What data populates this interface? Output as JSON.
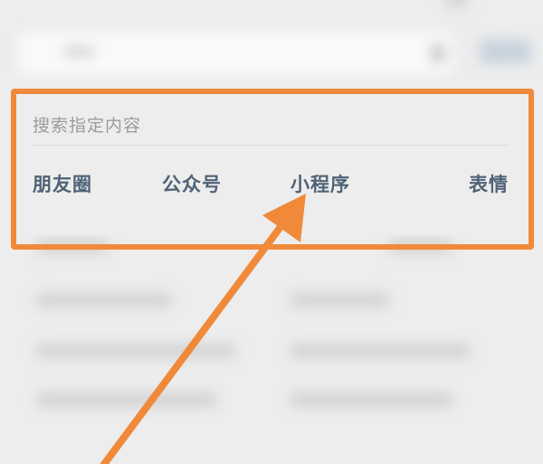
{
  "search_panel": {
    "hint": "搜索指定内容",
    "scopes": [
      {
        "label": "朋友圈"
      },
      {
        "label": "公众号"
      },
      {
        "label": "小程序"
      },
      {
        "label": "表情"
      }
    ]
  },
  "annotation": {
    "highlight_color": "#f08a3a",
    "arrow_color": "#f08a3a",
    "points_to": "小程序"
  },
  "colors": {
    "background": "#ededed",
    "scope_text": "#4f6276",
    "hint_text": "#9b9b9b"
  }
}
